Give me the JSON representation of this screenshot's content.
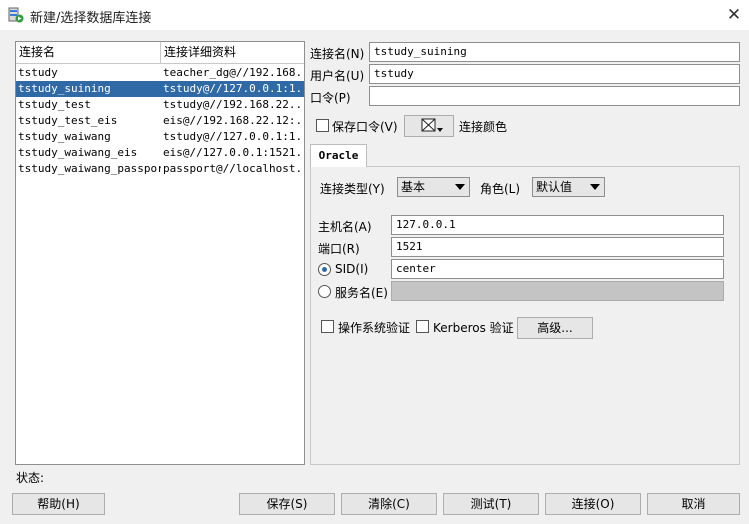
{
  "window": {
    "title": "新建/选择数据库连接",
    "close_glyph": "✕"
  },
  "list": {
    "headers": [
      "连接名",
      "连接详细资料"
    ],
    "rows": [
      {
        "name": "tstudy",
        "details": "teacher_dg@//192.168..."
      },
      {
        "name": "tstudy_suining",
        "details": "tstudy@//127.0.0.1:1..."
      },
      {
        "name": "tstudy_test",
        "details": "tstudy@//192.168.22..."
      },
      {
        "name": "tstudy_test_eis",
        "details": "eis@//192.168.22.12:..."
      },
      {
        "name": "tstudy_waiwang",
        "details": "tstudy@//127.0.0.1:1..."
      },
      {
        "name": "tstudy_waiwang_eis",
        "details": "eis@//127.0.0.1:1521..."
      },
      {
        "name": "tstudy_waiwang_passport",
        "details": "passport@//localhost..."
      }
    ],
    "selected_index": 1
  },
  "form": {
    "conn_name_label": "连接名(N)",
    "conn_name_value": "tstudy_suining",
    "user_label": "用户名(U)",
    "user_value": "tstudy",
    "password_label": "口令(P)",
    "password_value": "",
    "save_password_label": "保存口令(V)",
    "conn_color_label": "连接颜色"
  },
  "tab": {
    "label": "Oracle",
    "conn_type_label": "连接类型(Y)",
    "conn_type_value": "基本",
    "role_label": "角色(L)",
    "role_value": "默认值",
    "host_label": "主机名(A)",
    "host_value": "127.0.0.1",
    "port_label": "端口(R)",
    "port_value": "1521",
    "sid_label": "SID(I)",
    "sid_value": "center",
    "service_label": "服务名(E)",
    "service_value": "",
    "os_auth_label": "操作系统验证",
    "kerberos_label": "Kerberos 验证",
    "advanced_label": "高级..."
  },
  "status_label": "状态:",
  "buttons": {
    "help": "帮助(H)",
    "save": "保存(S)",
    "clear": "清除(C)",
    "test": "测试(T)",
    "connect": "连接(O)",
    "cancel": "取消"
  }
}
